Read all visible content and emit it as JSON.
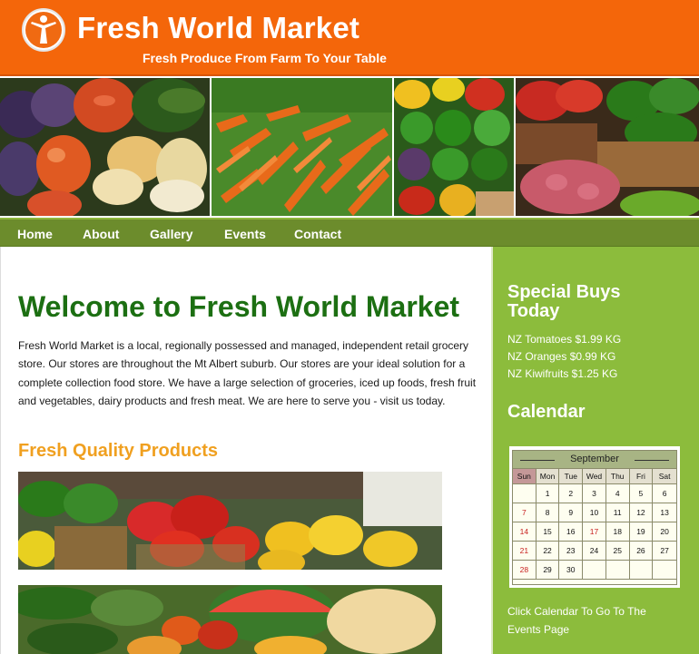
{
  "header": {
    "title": "Fresh World Market",
    "tagline": "Fresh Produce From Farm To Your Table",
    "logo_icon": "person-outline-icon",
    "bg_color": "#f4660a"
  },
  "banner": {
    "photos": [
      "assorted-squash-photo",
      "carrots-photo",
      "peppers-photo",
      "tomatoes-and-potatoes-photo"
    ]
  },
  "nav": {
    "items": [
      {
        "label": "Home"
      },
      {
        "label": "About"
      },
      {
        "label": "Gallery"
      },
      {
        "label": "Events"
      },
      {
        "label": "Contact"
      }
    ],
    "bg_color": "#6c8c2c"
  },
  "main": {
    "heading": "Welcome to Fresh World Market",
    "intro": "Fresh World Market is a local, regionally possessed and managed, independent retail grocery store. Our stores are throughout the Mt Albert suburb. Our stores are your ideal solution for a complete collection food store. We have a large selection of groceries, iced up foods, fresh fruit and vegetables, dairy products and fresh meat. We are here to serve you - visit us today.",
    "subheading": "Fresh Quality Products",
    "heading_color": "#1c6f12",
    "subheading_color": "#f0a020"
  },
  "sidebar": {
    "specials_title": "Special Buys Today",
    "specials": [
      "NZ Tomatoes $1.99 KG",
      "NZ Oranges $0.99 KG",
      "NZ Kiwifruits $1.25 KG"
    ],
    "calendar_title": "Calendar",
    "calendar_link_text": "Click Calendar To Go To The Events Page",
    "bg_color": "#8cbc3c"
  },
  "calendar": {
    "month": "September",
    "weekdays": [
      "Sun",
      "Mon",
      "Tue",
      "Wed",
      "Thu",
      "Fri",
      "Sat"
    ],
    "weeks": [
      [
        "",
        "1",
        "2",
        "3",
        "4",
        "5",
        "6"
      ],
      [
        "7",
        "8",
        "9",
        "10",
        "11",
        "12",
        "13"
      ],
      [
        "14",
        "15",
        "16",
        "17",
        "18",
        "19",
        "20"
      ],
      [
        "21",
        "22",
        "23",
        "24",
        "25",
        "26",
        "27"
      ],
      [
        "28",
        "29",
        "30",
        "",
        "",
        "",
        ""
      ]
    ],
    "highlighted_days": [
      "7",
      "14",
      "17",
      "21",
      "28"
    ]
  }
}
